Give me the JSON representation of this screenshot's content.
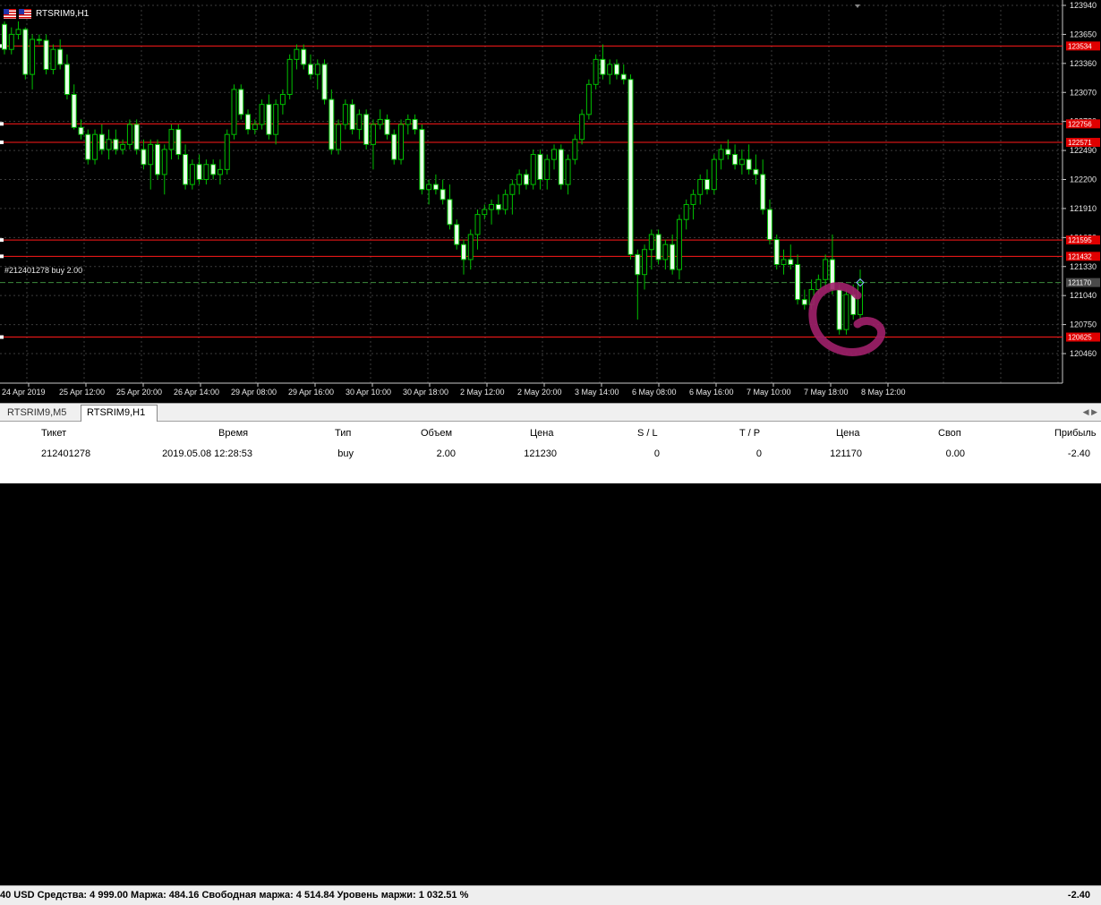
{
  "chart": {
    "title": "RTSRIM9,H1",
    "position_label": "#212401278 buy 2.00",
    "bg": "#000000",
    "bull_color": "#00c000",
    "bear_color": "#e8ffe8",
    "level_color": "#ff1a1a",
    "price_axis": [
      {
        "price": 123940,
        "label": "123940"
      },
      {
        "price": 123650,
        "label": "123650"
      },
      {
        "price": 123360,
        "label": "123360"
      },
      {
        "price": 123070,
        "label": "123070"
      },
      {
        "price": 122780,
        "label": "122780"
      },
      {
        "price": 122490,
        "label": "122490"
      },
      {
        "price": 122200,
        "label": "122200"
      },
      {
        "price": 121910,
        "label": "121910"
      },
      {
        "price": 121620,
        "label": "121620"
      },
      {
        "price": 121330,
        "label": "121330"
      },
      {
        "price": 121040,
        "label": "121040"
      },
      {
        "price": 120750,
        "label": "120750"
      },
      {
        "price": 120460,
        "label": "120460"
      }
    ],
    "levels": [
      {
        "price": 123534,
        "label": "123534"
      },
      {
        "price": 122756,
        "label": "122756"
      },
      {
        "price": 122571,
        "label": "122571"
      },
      {
        "price": 121595,
        "label": "121595"
      },
      {
        "price": 121432,
        "label": "121432"
      },
      {
        "price": 120625,
        "label": "120625"
      }
    ],
    "current_price": {
      "price": 121170,
      "label": "121170"
    },
    "time_axis": [
      "24 Apr 2019",
      "25 Apr 12:00",
      "25 Apr 20:00",
      "26 Apr 14:00",
      "29 Apr 08:00",
      "29 Apr 16:00",
      "30 Apr 10:00",
      "30 Apr 18:00",
      "2 May 12:00",
      "2 May 20:00",
      "3 May 14:00",
      "6 May 08:00",
      "6 May 16:00",
      "7 May 10:00",
      "7 May 18:00",
      "8 May 12:00"
    ],
    "candles": [
      [
        123750,
        123780,
        123450,
        123500
      ],
      [
        123500,
        123720,
        123450,
        123650
      ],
      [
        123650,
        123780,
        123600,
        123700
      ],
      [
        123700,
        123720,
        123200,
        123250
      ],
      [
        123250,
        123650,
        123100,
        123600
      ],
      [
        123600,
        123650,
        123550,
        123590
      ],
      [
        123590,
        123650,
        123250,
        123300
      ],
      [
        123300,
        123550,
        123250,
        123500
      ],
      [
        123500,
        123600,
        123300,
        123350
      ],
      [
        123350,
        123450,
        123000,
        123050
      ],
      [
        123050,
        123150,
        122700,
        122720
      ],
      [
        122720,
        122800,
        122600,
        122650
      ],
      [
        122650,
        122700,
        122350,
        122400
      ],
      [
        122400,
        122700,
        122350,
        122650
      ],
      [
        122650,
        122750,
        122450,
        122500
      ],
      [
        122500,
        122700,
        122400,
        122600
      ],
      [
        122600,
        122700,
        122450,
        122500
      ],
      [
        122500,
        122600,
        122450,
        122550
      ],
      [
        122550,
        122800,
        122500,
        122750
      ],
      [
        122750,
        122800,
        122450,
        122500
      ],
      [
        122500,
        122600,
        122300,
        122350
      ],
      [
        122350,
        122600,
        122100,
        122550
      ],
      [
        122550,
        122600,
        122200,
        122250
      ],
      [
        122250,
        122550,
        122050,
        122500
      ],
      [
        122500,
        122750,
        122400,
        122700
      ],
      [
        122700,
        122750,
        122400,
        122450
      ],
      [
        122450,
        122550,
        122100,
        122150
      ],
      [
        122150,
        122400,
        122100,
        122350
      ],
      [
        122350,
        122450,
        122150,
        122200
      ],
      [
        122200,
        122400,
        122150,
        122350
      ],
      [
        122350,
        122400,
        122200,
        122250
      ],
      [
        122250,
        122400,
        122150,
        122300
      ],
      [
        122300,
        122700,
        122250,
        122650
      ],
      [
        122650,
        123150,
        122600,
        123100
      ],
      [
        123100,
        123150,
        122800,
        122850
      ],
      [
        122850,
        122900,
        122650,
        122700
      ],
      [
        122700,
        122800,
        122650,
        122750
      ],
      [
        122750,
        123000,
        122700,
        122950
      ],
      [
        122950,
        123050,
        122600,
        122650
      ],
      [
        122650,
        123000,
        122550,
        122950
      ],
      [
        122950,
        123100,
        122850,
        123050
      ],
      [
        123050,
        123450,
        123000,
        123400
      ],
      [
        123400,
        123550,
        123300,
        123500
      ],
      [
        123500,
        123550,
        123300,
        123350
      ],
      [
        123350,
        123450,
        123200,
        123250
      ],
      [
        123250,
        123400,
        123100,
        123350
      ],
      [
        123350,
        123400,
        122950,
        123000
      ],
      [
        123000,
        123100,
        122450,
        122500
      ],
      [
        122500,
        122800,
        122450,
        122750
      ],
      [
        122750,
        123000,
        122700,
        122950
      ],
      [
        122950,
        123000,
        122650,
        122700
      ],
      [
        122700,
        122900,
        122600,
        122850
      ],
      [
        122850,
        122900,
        122500,
        122550
      ],
      [
        122550,
        122800,
        122300,
        122750
      ],
      [
        122750,
        122900,
        122700,
        122800
      ],
      [
        122800,
        122850,
        122600,
        122650
      ],
      [
        122650,
        122700,
        122350,
        122400
      ],
      [
        122400,
        122800,
        122350,
        122750
      ],
      [
        122750,
        122850,
        122650,
        122800
      ],
      [
        122800,
        122850,
        122650,
        122700
      ],
      [
        122700,
        122750,
        122050,
        122100
      ],
      [
        122100,
        122200,
        121950,
        122150
      ],
      [
        122150,
        122250,
        122050,
        122100
      ],
      [
        122100,
        122200,
        121950,
        122000
      ],
      [
        122000,
        122150,
        121700,
        121750
      ],
      [
        121750,
        121800,
        121500,
        121550
      ],
      [
        121550,
        121600,
        121250,
        121400
      ],
      [
        121400,
        121700,
        121300,
        121650
      ],
      [
        121650,
        121900,
        121500,
        121850
      ],
      [
        121850,
        121950,
        121800,
        121900
      ],
      [
        121900,
        122000,
        121750,
        121950
      ],
      [
        121950,
        122050,
        121850,
        121900
      ],
      [
        121900,
        122100,
        121850,
        122050
      ],
      [
        122050,
        122200,
        121850,
        122150
      ],
      [
        122150,
        122300,
        122050,
        122250
      ],
      [
        122250,
        122300,
        122100,
        122150
      ],
      [
        122150,
        122500,
        122100,
        122450
      ],
      [
        122450,
        122500,
        122100,
        122200
      ],
      [
        122200,
        122450,
        122100,
        122400
      ],
      [
        122400,
        122550,
        122300,
        122500
      ],
      [
        122500,
        122550,
        122100,
        122150
      ],
      [
        122150,
        122450,
        122050,
        122400
      ],
      [
        122400,
        122650,
        122350,
        122600
      ],
      [
        122600,
        122900,
        122550,
        122850
      ],
      [
        122850,
        123200,
        122800,
        123150
      ],
      [
        123150,
        123450,
        123100,
        123400
      ],
      [
        123400,
        123550,
        123200,
        123250
      ],
      [
        123250,
        123400,
        123150,
        123350
      ],
      [
        123350,
        123400,
        123200,
        123250
      ],
      [
        123250,
        123350,
        123150,
        123200
      ],
      [
        123200,
        123250,
        121400,
        121450
      ],
      [
        121450,
        121500,
        120800,
        121250
      ],
      [
        121250,
        121550,
        121100,
        121500
      ],
      [
        121500,
        121700,
        121300,
        121650
      ],
      [
        121650,
        121700,
        121350,
        121400
      ],
      [
        121400,
        121600,
        121300,
        121550
      ],
      [
        121550,
        121650,
        121250,
        121300
      ],
      [
        121300,
        121850,
        121200,
        121800
      ],
      [
        121800,
        122000,
        121700,
        121950
      ],
      [
        121950,
        122100,
        121800,
        122050
      ],
      [
        122050,
        122250,
        121950,
        122200
      ],
      [
        122200,
        122300,
        122050,
        122100
      ],
      [
        122100,
        122450,
        122050,
        122400
      ],
      [
        122400,
        122550,
        122300,
        122500
      ],
      [
        122500,
        122600,
        122400,
        122450
      ],
      [
        122450,
        122550,
        122300,
        122350
      ],
      [
        122350,
        122500,
        122250,
        122400
      ],
      [
        122400,
        122550,
        122250,
        122300
      ],
      [
        122300,
        122450,
        122150,
        122250
      ],
      [
        122250,
        122400,
        121850,
        121900
      ],
      [
        121900,
        122000,
        121550,
        121600
      ],
      [
        121600,
        121650,
        121300,
        121350
      ],
      [
        121350,
        121500,
        121250,
        121400
      ],
      [
        121400,
        121550,
        121300,
        121350
      ],
      [
        121350,
        121450,
        120950,
        121000
      ],
      [
        121000,
        121100,
        120900,
        120950
      ],
      [
        120950,
        121200,
        120900,
        121100
      ],
      [
        121100,
        121250,
        121050,
        121200
      ],
      [
        121200,
        121450,
        121100,
        121400
      ],
      [
        121400,
        121650,
        121050,
        121100
      ],
      [
        121100,
        121150,
        120650,
        120700
      ],
      [
        120700,
        121100,
        120650,
        121050
      ],
      [
        121050,
        121150,
        120800,
        120850
      ],
      [
        120850,
        121300,
        120800,
        121170
      ]
    ]
  },
  "tabs": [
    {
      "label": "RTSRIM9,M5"
    },
    {
      "label": "RTSRIM9,H1"
    }
  ],
  "table": {
    "headers": [
      "Тикет",
      "Время",
      "Тип",
      "Объем",
      "Цена",
      "S / L",
      "T / P",
      "Цена",
      "Своп",
      "Прибыль"
    ],
    "row": [
      "212401278",
      "2019.05.08 12:28:53",
      "buy",
      "2.00",
      "121230",
      "0",
      "0",
      "121170",
      "0.00",
      "-2.40"
    ]
  },
  "summary": {
    "text": "40 USD  Средства: 4 999.00  Маржа: 484.16  Свободная маржа: 4 514.84  Уровень маржи: 1 032.51 %",
    "total": "-2.40"
  }
}
